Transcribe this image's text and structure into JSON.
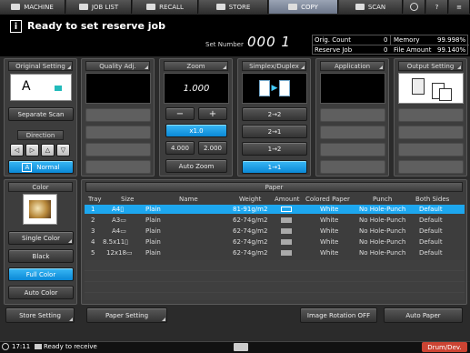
{
  "tabs": [
    {
      "label": "MACHINE"
    },
    {
      "label": "JOB LIST"
    },
    {
      "label": "RECALL"
    },
    {
      "label": "STORE"
    },
    {
      "label": "COPY"
    },
    {
      "label": "SCAN"
    }
  ],
  "status": {
    "message": "Ready to set reserve job",
    "set_number_label": "Set Number",
    "set_number": "000 1"
  },
  "counters": {
    "orig_count_label": "Orig. Count",
    "orig_count": "0",
    "memory_label": "Memory",
    "memory": "99.998%",
    "reserve_job_label": "Reserve Job",
    "reserve_job": "0",
    "file_amount_label": "File Amount",
    "file_amount": "99.140%"
  },
  "original_setting": {
    "title": "Original Setting",
    "icon_letter": "A",
    "separate_scan": "Separate Scan",
    "direction_label": "Direction",
    "normal": "Normal"
  },
  "quality": {
    "title": "Quality Adj."
  },
  "zoom": {
    "title": "Zoom",
    "value": "1.000",
    "minus": "−",
    "plus": "+",
    "x10": "x1.0",
    "p4": "4.000",
    "p2": "2.000",
    "auto": "Auto Zoom"
  },
  "simplex": {
    "title": "Simplex/Duplex",
    "opt1": "2→2",
    "opt2": "2→1",
    "opt3": "1→2",
    "opt4": "1→1"
  },
  "application": {
    "title": "Application"
  },
  "output": {
    "title": "Output Setting"
  },
  "color": {
    "title": "Color",
    "single": "Single Color",
    "black": "Black",
    "full": "Full Color",
    "auto": "Auto Color"
  },
  "paper": {
    "title": "Paper",
    "headers": {
      "tray": "Tray",
      "size": "Size",
      "name": "Name",
      "weight": "Weight",
      "amount": "Amount",
      "colored": "Colored Paper",
      "punch": "Punch",
      "both": "Both Sides"
    },
    "rows": [
      {
        "tray": "1",
        "size": "A4▯",
        "name": "Plain",
        "weight": "81-91g/m2",
        "colored": "White",
        "punch": "No Hole-Punch",
        "both": "Default"
      },
      {
        "tray": "2",
        "size": "A3▭",
        "name": "Plain",
        "weight": "62-74g/m2",
        "colored": "White",
        "punch": "No Hole-Punch",
        "both": "Default"
      },
      {
        "tray": "3",
        "size": "A4▭",
        "name": "Plain",
        "weight": "62-74g/m2",
        "colored": "White",
        "punch": "No Hole-Punch",
        "both": "Default"
      },
      {
        "tray": "4",
        "size": "8.5x11▯",
        "name": "Plain",
        "weight": "62-74g/m2",
        "colored": "White",
        "punch": "No Hole-Punch",
        "both": "Default"
      },
      {
        "tray": "5",
        "size": "12x18▭",
        "name": "Plain",
        "weight": "62-74g/m2",
        "colored": "White",
        "punch": "No Hole-Punch",
        "both": "Default"
      }
    ]
  },
  "bottom": {
    "store_setting": "Store Setting",
    "paper_setting": "Paper Setting",
    "image_rotation": "Image Rotation OFF",
    "auto_paper": "Auto Paper"
  },
  "footer": {
    "time": "17:11",
    "status": "Ready to receive",
    "drum": "Drum/Dev."
  }
}
